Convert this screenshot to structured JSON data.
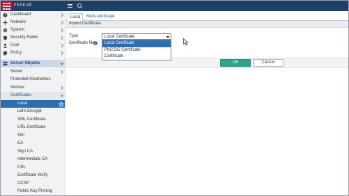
{
  "header": {
    "brand": "FSSEGE",
    "icons": [
      "fortinet-logo",
      "menu-icon",
      "search-icon"
    ]
  },
  "sidebar": {
    "items": [
      {
        "label": "Dashboard",
        "icon": "dashboard-icon"
      },
      {
        "label": "Network",
        "icon": "network-icon"
      },
      {
        "label": "System",
        "icon": "gear-icon"
      },
      {
        "label": "Security Fabric",
        "icon": "shield-icon"
      },
      {
        "label": "User",
        "icon": "user-icon"
      },
      {
        "label": "Policy",
        "icon": "policy-icon"
      },
      {
        "label": "Server Objects",
        "icon": "server-icon"
      }
    ],
    "server_objects": {
      "children": [
        "Server",
        "Protected Hostnames",
        "Service",
        "Certificates"
      ],
      "certificates": [
        "Local",
        "Let's Encrypt",
        "XML Certificate",
        "URL Certificate",
        "SNI",
        "CA",
        "Sign CA",
        "Intermediate CA",
        "CRL",
        "Certificate Verify",
        "OCSP",
        "Public Key Pinning"
      ]
    }
  },
  "tabs": [
    "Local",
    "Multi-certificate"
  ],
  "dialog": {
    "title": "Import Certificate",
    "type_label": "Type",
    "file_label": "Certificate file",
    "type_value": "Local Certificate",
    "options": [
      "Local Certificate",
      "PKCS12 Certificate",
      "Certificate"
    ]
  },
  "buttons": {
    "ok": "OK",
    "cancel": "Cancel"
  },
  "colors": {
    "topbar": "#1f3f66",
    "logo": "#c8102e",
    "selection": "#2f6db0",
    "ok_button": "#2ea58b"
  }
}
